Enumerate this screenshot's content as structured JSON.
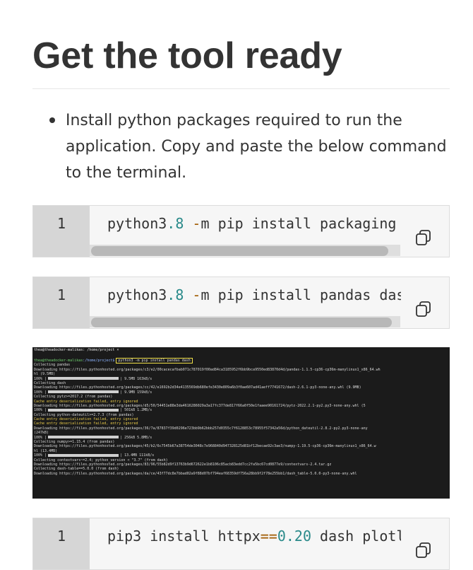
{
  "heading": "Get the tool ready",
  "instruction": "Install python packages required to run the application. Copy and paste the below command to the terminal.",
  "code_blocks": [
    {
      "line_number": "1",
      "parts": [
        "python3",
        ".8",
        " -",
        "m pip install packaging"
      ],
      "scroll_fraction": 0.9
    },
    {
      "line_number": "1",
      "parts": [
        "python3",
        ".8",
        " -",
        "m pip install pandas dash"
      ],
      "scroll_fraction": 0.91
    },
    {
      "line_number": "1",
      "parts": [
        "pip3 install httpx",
        "==",
        "0.20",
        " dash plotly"
      ],
      "scroll_fraction": 0.9
    }
  ],
  "terminal": {
    "tab_title": "thea@theadocker-malikas: /home/project ×",
    "prompt_user": "thea@theadocker-malikas",
    "prompt_path": ":/home/project$",
    "command": "python3 -m pip install pandas dash",
    "lines": [
      {
        "text": "Collecting pandas",
        "color": ""
      },
      {
        "text": "  Downloading https://files.pythonhosted.org/packages/c3/e2/00cacecafbab071c787019f00ad84ca3185952f6bb9bca9550ed83870d4d/pandas-1.1.5-cp36-cp36m-manylinux1_x86_64.wh",
        "color": ""
      },
      {
        "text": "hl (9.5MB)",
        "color": ""
      },
      {
        "text": "     100% |",
        "bar": true,
        "after": "| 9.5MB 163kB/s",
        "color": ""
      },
      {
        "text": "Collecting dash",
        "color": ""
      },
      {
        "text": "  Downloading https://files.pythonhosted.org/packages/cc/42/e1692b2d34e4135569db680efe3430e809a6b3f0ae607ad41aeff7741672/dash-2.6.1-py3-none-any.whl (9.9MB)",
        "color": ""
      },
      {
        "text": "     100% |",
        "bar": true,
        "after": "| 9.9MB 159kB/s",
        "color": ""
      },
      {
        "text": "Collecting pytz>=2017.2 (from pandas)",
        "color": ""
      },
      {
        "text": "  Cache entry deserialization failed, entry ignored",
        "color": "y"
      },
      {
        "text": "  Downloading https://files.pythonhosted.org/packages/d5/50/54451e88e3da4616286029a3a17fc377de817f66a0f50e1faaee90161724/pytz-2022.2.1-py2.py3-none-any.whl (5",
        "color": ""
      },
      {
        "text": "     100% |",
        "bar": true,
        "after": "| 501kB 1.2MB/s",
        "color": ""
      },
      {
        "text": "Collecting python-dateutil>=2.7.3 (from pandas)",
        "color": ""
      },
      {
        "text": "  Cache entry deserialization failed, entry ignored",
        "color": "y"
      },
      {
        "text": "  Cache entry deserialization failed, entry ignored",
        "color": "y"
      },
      {
        "text": "  Downloading https://files.pythonhosted.org/packages/36/7a/87837f39d0296e723bb9b62bbb257d0355c7f6128853c78955f57342a56d/python_dateutil-2.8.2-py2.py3-none-any",
        "color": ""
      },
      {
        "text": "(247kB)",
        "color": ""
      },
      {
        "text": "     100% |",
        "bar": true,
        "after": "| 256kB 5.8MB/s",
        "color": ""
      },
      {
        "text": "Collecting numpy>=1.15.4 (from pandas)",
        "color": ""
      },
      {
        "text": "  Downloading https://files.pythonhosted.org/packages/45/b2/6c7545b67a38754de3048c7e968840d947328125d81bf12becae92c3ae3/numpy-1.19.5-cp36-cp36m-manylinux1_x86_64.w",
        "color": ""
      },
      {
        "text": "hl (13.4MB)",
        "color": ""
      },
      {
        "text": "     100% |",
        "bar": true,
        "after": "| 13.4MB 111kB/s",
        "color": ""
      },
      {
        "text": "Collecting contextvars~=2.4; python_version < \"3.7\" (from dash)",
        "color": ""
      },
      {
        "text": "  Downloading https://files.pythonhosted.org/packages/83/96/55b82d9f13763b9d672622e1b8106c85acb83edd7cc2fa5bc67cd0877e9/contextvars-2.4.tar.gz",
        "color": ""
      },
      {
        "text": "Collecting dash-table==5.0.0 (from dash)",
        "color": ""
      },
      {
        "text": "  Downloading https://files.pythonhosted.org/packages/da/ce/43f77dc8e7bbad02a9f88d07bf794eaf68359df756a28bb9f2f78e255bb1/dash_table-5.0.0-py3-none-any.whl",
        "color": ""
      }
    ]
  },
  "colors": {
    "number": "#2a8a8a",
    "operator": "#a05a00",
    "terminal_bg": "#1b1b1b",
    "prompt_green": "#6fd26f",
    "prompt_blue": "#8cb4ff",
    "warning_yellow": "#e6c84a"
  },
  "icons": {
    "copy": "copy-icon"
  }
}
